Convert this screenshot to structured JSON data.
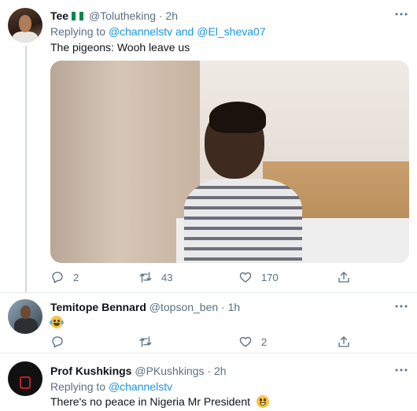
{
  "tweets": [
    {
      "name": "Tee",
      "handle": "@Tolutheking",
      "dot": "·",
      "time": "2h",
      "flag_colors": [
        "#008751",
        "#ffffff",
        "#008751"
      ],
      "replying_prefix": "Replying to",
      "replying_to_1": "@channelstv",
      "replying_and": "and",
      "replying_to_2": "@El_sheva07",
      "text": "The pigeons: Wooh leave us",
      "media": "gif-child-on-bed",
      "reply_count": "2",
      "retweet_count": "43",
      "like_count": "170"
    },
    {
      "name": "Temitope Bennard",
      "handle": "@topson_ben",
      "dot": "·",
      "time": "1h",
      "text_emoji": "face-with-tears-of-joy",
      "reply_count": "",
      "retweet_count": "",
      "like_count": "2"
    },
    {
      "name": "Prof Kushkings",
      "handle": "@PKushkings",
      "dot": "·",
      "time": "2h",
      "replying_prefix": "Replying to",
      "replying_to_1": "@channelstv",
      "text": "There's no peace in Nigeria Mr President",
      "text_emoji": "grinning-face"
    }
  ],
  "icons": {
    "more": "more-icon",
    "reply": "reply-icon",
    "retweet": "retweet-icon",
    "like": "like-icon",
    "share": "share-icon"
  },
  "colors": {
    "link": "#1b95e0",
    "secondary_text": "#5b7083",
    "divider": "#e6ecf0"
  }
}
